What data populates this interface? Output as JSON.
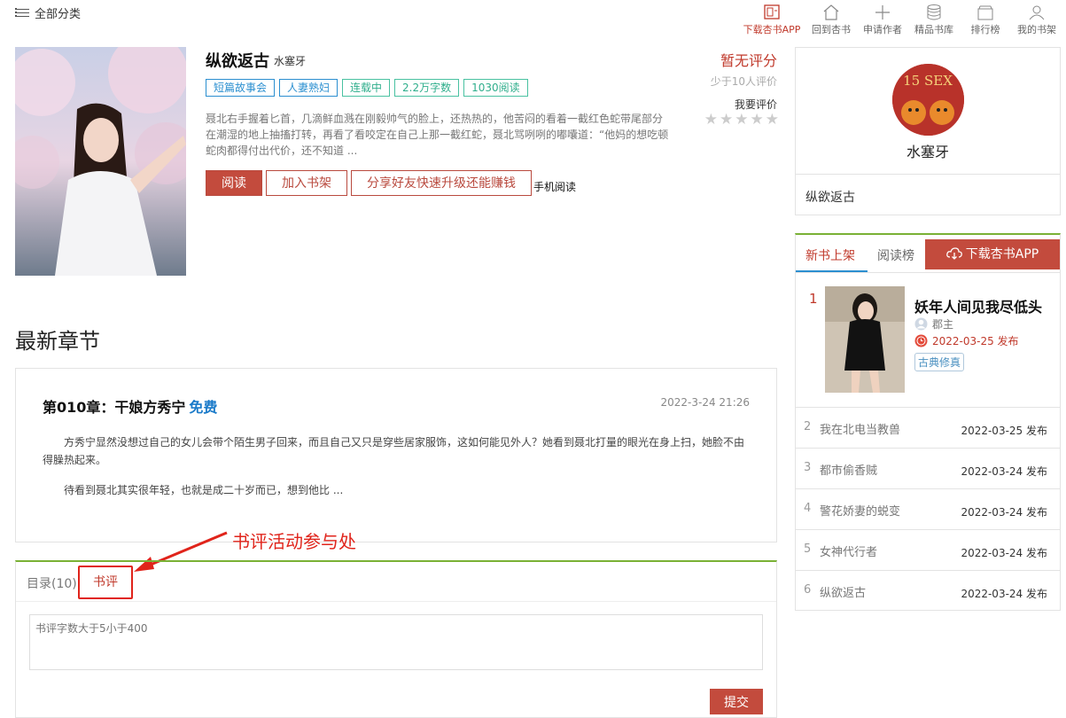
{
  "topbar": {
    "category_label": "全部分类",
    "nav": [
      {
        "label": "下载杏书APP",
        "icon": "tablet-icon"
      },
      {
        "label": "回到杏书",
        "icon": "home-icon"
      },
      {
        "label": "申请作者",
        "icon": "plus-icon"
      },
      {
        "label": "精品书库",
        "icon": "database-icon"
      },
      {
        "label": "排行榜",
        "icon": "box-icon"
      },
      {
        "label": "我的书架",
        "icon": "user-icon"
      }
    ]
  },
  "book": {
    "title": "纵欲返古",
    "author": "水塞牙",
    "tags": [
      "短篇故事会",
      "人妻熟妇",
      "连载中",
      "2.2万字数",
      "1030阅读"
    ],
    "description": "聂北右手握着匕首，几滴鲜血溅在刚毅帅气的脸上，还热热的，他苦闷的看着一截红色蛇带尾部分在潮湿的地上抽搐打转，再看了看咬定在自己上那一截红蛇，聂北骂咧咧的嘟囔道：“他妈的想吃顿蛇肉都得付出代价，还不知道 ...",
    "btn_read": "阅读",
    "btn_shelf": "加入书架",
    "btn_share": "分享好友快速升级还能赚钱",
    "mobile_read": "手机阅读",
    "score": "暂无评分",
    "few_ratings": "少于10人评价",
    "want_rate": "我要评价",
    "stars": [
      "★",
      "★",
      "★",
      "★",
      "★"
    ]
  },
  "latest": {
    "heading": "最新章节",
    "chapter_title": "第010章：干娘方秀宁",
    "free": "免费",
    "time": "2022-3-24 21:26",
    "para1": "方秀宁显然没想过自己的女儿会带个陌生男子回来，而且自己又只是穿些居家服饰，这如何能见外人？她看到聂北打量的眼光在身上扫，她脸不由得臊热起来。",
    "para2": "待看到聂北其实很年轻，也就是成二十岁而已，想到他比 ..."
  },
  "annotation": "书评活动参与处",
  "tabs": {
    "dir": "目录(10)",
    "review": "书评",
    "placeholder": "书评字数大于5小于400",
    "submit": "提交"
  },
  "author_box": {
    "avatar_text": "15 SEX",
    "name": "水塞牙",
    "book": "纵欲返古"
  },
  "rank": {
    "tab_new": "新书上架",
    "tab_read": "阅读榜",
    "download": "下载杏书APP",
    "first": {
      "num": "1",
      "title": "妖年人间见我尽低头",
      "author": "郡主",
      "date": "2022-03-25 发布",
      "tag": "古典修真"
    },
    "rows": [
      {
        "num": "2",
        "title": "我在北电当教兽",
        "date": "2022-03-25 发布"
      },
      {
        "num": "3",
        "title": "都市偷香贼",
        "date": "2022-03-24 发布"
      },
      {
        "num": "4",
        "title": "警花娇妻的蜕变",
        "date": "2022-03-24 发布"
      },
      {
        "num": "5",
        "title": "女神代行者",
        "date": "2022-03-24 发布"
      },
      {
        "num": "6",
        "title": "纵欲返古",
        "date": "2022-03-24 发布"
      }
    ]
  }
}
